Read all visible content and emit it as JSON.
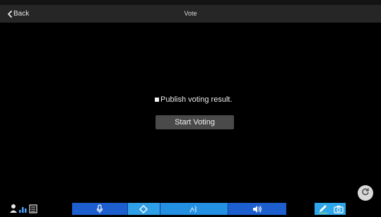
{
  "header": {
    "back_label": "Back",
    "title": "Vote"
  },
  "vote": {
    "publish_label": "Publish voting result.",
    "publish_checked": false,
    "start_label": "Start Voting"
  },
  "toolbar": {
    "left_icons": [
      "user-icon",
      "bar-chart-icon",
      "list-icon"
    ],
    "buttons": [
      {
        "name": "microphone-icon",
        "color": "#1e5fd0"
      },
      {
        "name": "camera-toggle-icon",
        "color": "#2f9fe8"
      },
      {
        "name": "hand-raise-icon",
        "color": "#2490e4"
      },
      {
        "name": "volume-icon",
        "color": "#1e5fd0"
      },
      {
        "name": "pen-icon",
        "color": "#2ea7ea"
      },
      {
        "name": "camera-icon",
        "color": "#2ea7ea"
      }
    ]
  },
  "colors": {
    "background": "#000000",
    "header": "#262626",
    "button": "#4a4a4a",
    "accent_blue": "#1e5fd0",
    "accent_light_blue": "#2ea7ea"
  }
}
